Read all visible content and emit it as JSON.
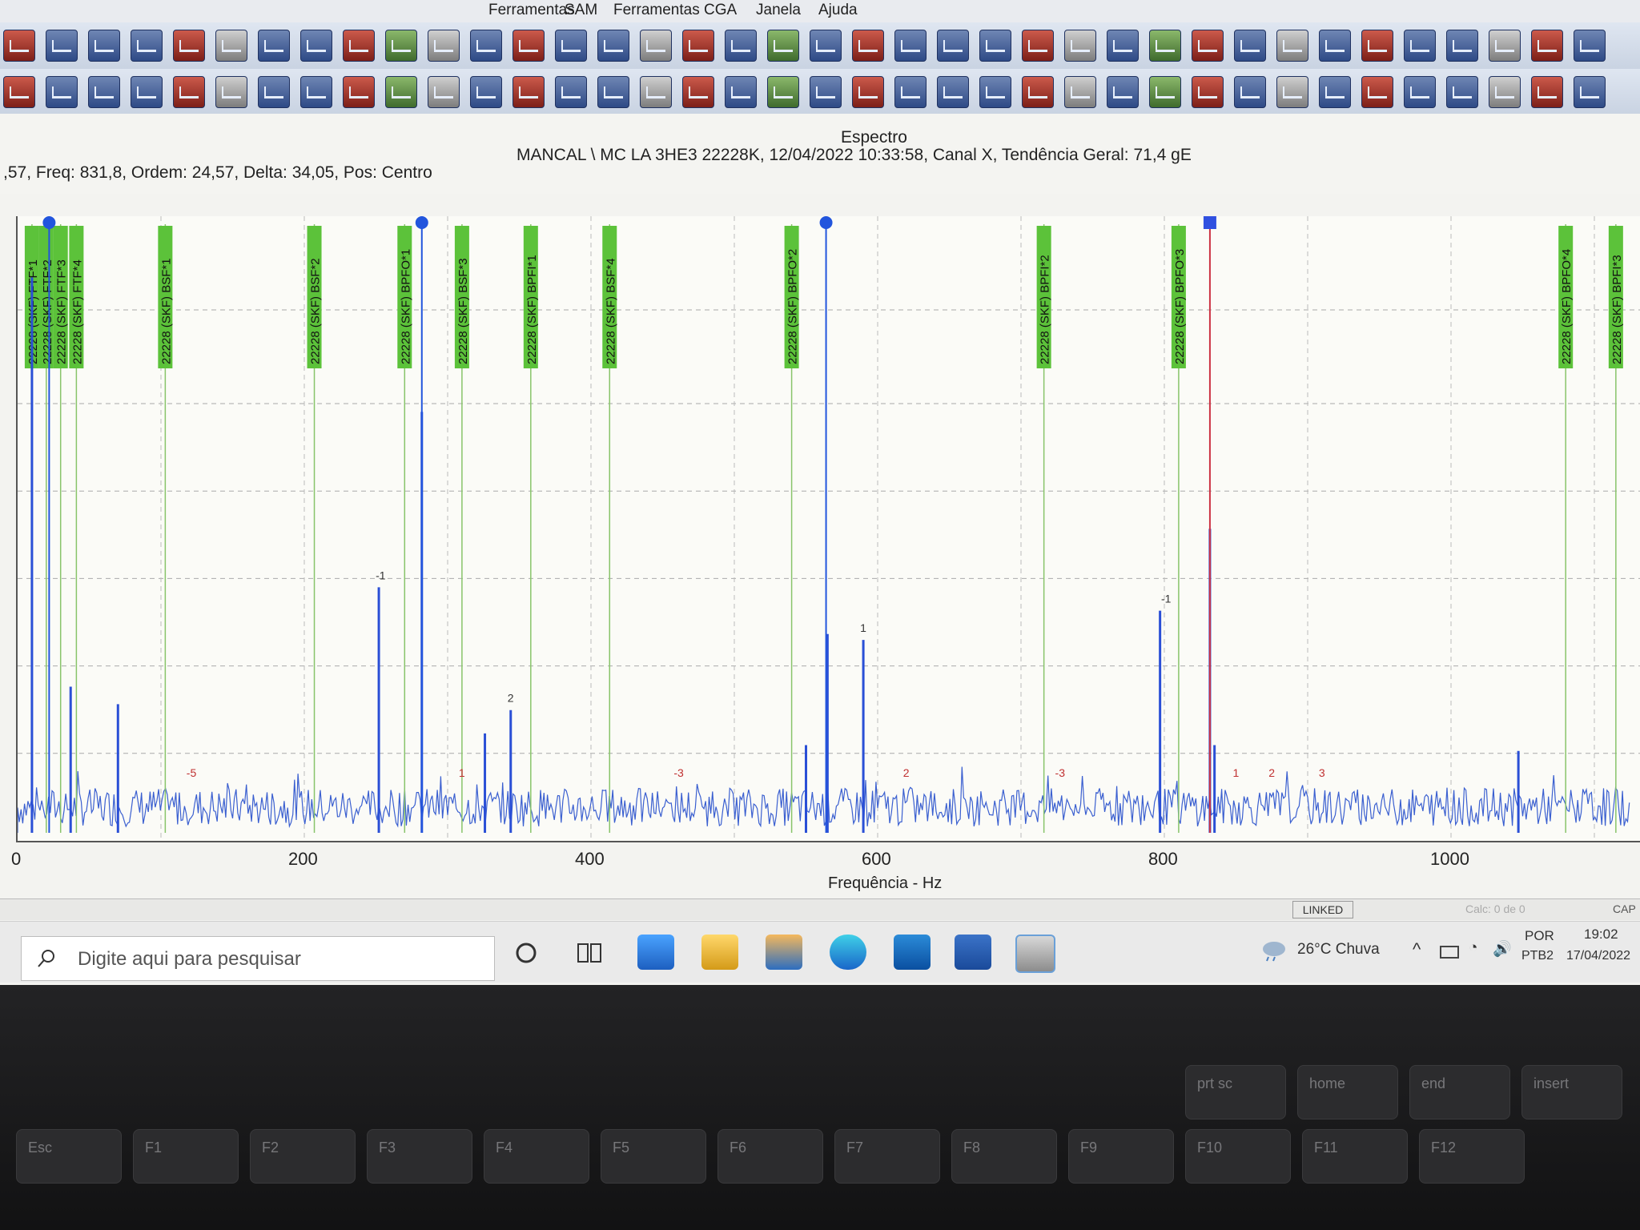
{
  "menubar": {
    "items": [
      "Ferramentas",
      "SAM",
      "Ferramentas CGA",
      "Janela",
      "Ajuda"
    ]
  },
  "header": {
    "chart_type_title": "Espectro",
    "cursor_info": ",57, Freq: 831,8, Ordem: 24,57, Delta: 34,05, Pos: Centro",
    "measurement_info": "MANCAL \\ MC LA  3HE3  22228K, 12/04/2022 10:33:58, Canal X, Tendência Geral: 71,4 gE"
  },
  "chart_data": {
    "type": "line",
    "title": "Espectro",
    "xlabel": "Frequência - Hz",
    "ylabel": "",
    "xlim": [
      0,
      1120
    ],
    "x_ticks": [
      0,
      200,
      400,
      600,
      800,
      1000
    ],
    "x_tick_labels": [
      "0",
      "200",
      "400",
      "600",
      "800",
      "1000"
    ],
    "grid": true,
    "fault_markers": [
      {
        "label": "22228 (SKF) FTF*1",
        "freq": 10
      },
      {
        "label": "22228 (SKF) FTF*2",
        "freq": 20
      },
      {
        "label": "22228 (SKF) FTF*3",
        "freq": 30
      },
      {
        "label": "22228 (SKF) FTF*4",
        "freq": 41
      },
      {
        "label": "22228 (SKF) BSF*1",
        "freq": 103
      },
      {
        "label": "22228 (SKF) BSF*2",
        "freq": 207
      },
      {
        "label": "22228 (SKF) BPFO*1",
        "freq": 270
      },
      {
        "label": "22228 (SKF) BSF*3",
        "freq": 310
      },
      {
        "label": "22228 (SKF) BPFI*1",
        "freq": 358
      },
      {
        "label": "22228 (SKF) BSF*4",
        "freq": 413
      },
      {
        "label": "22228 (SKF) BPFO*2",
        "freq": 540
      },
      {
        "label": "22228 (SKF) BPFI*2",
        "freq": 716
      },
      {
        "label": "22228 (SKF) BPFO*3",
        "freq": 810
      },
      {
        "label": "22228 (SKF) BPFO*4",
        "freq": 1080
      },
      {
        "label": "22228 (SKF) BPFI*3",
        "freq": 1115
      }
    ],
    "cursors": [
      {
        "freq": 22,
        "color": "#2255dd"
      },
      {
        "freq": 282,
        "color": "#2255dd"
      },
      {
        "freq": 564,
        "color": "#2255dd"
      },
      {
        "freq": 831.8,
        "color": "#cc3344"
      }
    ],
    "peaks": [
      {
        "freq": 10,
        "amp": 0.95
      },
      {
        "freq": 37,
        "amp": 0.25
      },
      {
        "freq": 70,
        "amp": 0.22
      },
      {
        "freq": 252,
        "amp": 0.42
      },
      {
        "freq": 282,
        "amp": 0.72
      },
      {
        "freq": 326,
        "amp": 0.17
      },
      {
        "freq": 344,
        "amp": 0.21
      },
      {
        "freq": 550,
        "amp": 0.15
      },
      {
        "freq": 565,
        "amp": 0.34
      },
      {
        "freq": 590,
        "amp": 0.33
      },
      {
        "freq": 797,
        "amp": 0.38
      },
      {
        "freq": 831.8,
        "amp": 0.52
      },
      {
        "freq": 835,
        "amp": 0.15
      },
      {
        "freq": 1047,
        "amp": 0.14
      }
    ],
    "sideband_labels": [
      {
        "text": "-1",
        "freq": 252
      },
      {
        "text": "1",
        "freq": 310
      },
      {
        "text": "2",
        "freq": 344
      },
      {
        "text": "1",
        "freq": 590
      },
      {
        "text": "-1",
        "freq": 800
      },
      {
        "text": "-5",
        "freq": 120
      },
      {
        "text": "-3",
        "freq": 460
      },
      {
        "text": "2",
        "freq": 620
      },
      {
        "text": "-3",
        "freq": 726
      },
      {
        "text": "1",
        "freq": 850
      },
      {
        "text": "2",
        "freq": 875
      },
      {
        "text": "3",
        "freq": 910
      }
    ]
  },
  "statusbar": {
    "linked": "LINKED",
    "calc": "Calc: 0 de 0",
    "caps": "CAP"
  },
  "taskbar": {
    "search_placeholder": "Digite aqui para pesquisar",
    "weather": "26°C  Chuva",
    "lang": "POR",
    "layout": "PTB2",
    "time": "19:02",
    "date": "17/04/2022"
  },
  "keyboard": {
    "keys": [
      "Esc",
      "F1",
      "F2",
      "F3",
      "F4",
      "F5",
      "F6",
      "F7",
      "F8",
      "F9",
      "F10",
      "F11",
      "F12"
    ],
    "extra": [
      "prt sc",
      "home",
      "end",
      "insert"
    ]
  }
}
